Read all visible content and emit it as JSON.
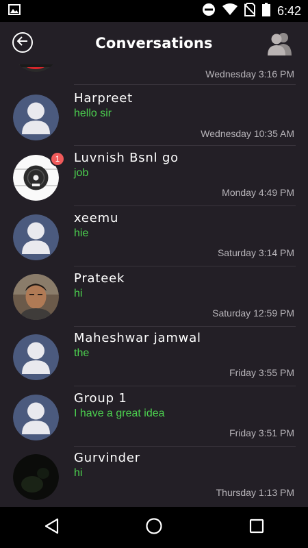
{
  "status_bar": {
    "time": "6:42",
    "icons": [
      "image-notification-icon",
      "do-not-disturb-icon",
      "wifi-icon",
      "no-sim-icon",
      "battery-icon"
    ]
  },
  "header": {
    "title": "Conversations",
    "back_icon": "back-arrow-circle-icon",
    "contacts_icon": "contacts-people-icon"
  },
  "conversations": [
    {
      "name": "",
      "message": "",
      "time": "Wednesday 3:16 PM",
      "avatar": "partial-red-avatar"
    },
    {
      "name": "Harpreet",
      "message": "hello sir",
      "time": "Wednesday 10:35 AM",
      "avatar": "default-person"
    },
    {
      "name": "Luvnish Bsnl go",
      "message": "job",
      "time": "Monday 4:49 PM",
      "avatar": "record-player",
      "unread": "1"
    },
    {
      "name": "xeemu",
      "message": "hie",
      "time": "Saturday 3:14 PM",
      "avatar": "default-person"
    },
    {
      "name": "Prateek",
      "message": "hi",
      "time": "Saturday 12:59 PM",
      "avatar": "photo-face"
    },
    {
      "name": "Maheshwar jamwal",
      "message": "the",
      "time": "Friday 3:55 PM",
      "avatar": "default-person"
    },
    {
      "name": "Group 1",
      "message": "I have a great idea",
      "time": "Friday 3:51 PM",
      "avatar": "default-person"
    },
    {
      "name": "Gurvinder",
      "message": "hi",
      "time": "Thursday 1:13 PM",
      "avatar": "dark-photo"
    }
  ],
  "nav_bar": {
    "icons": [
      "back-triangle-icon",
      "home-circle-icon",
      "recents-square-icon"
    ]
  },
  "colors": {
    "background": "#231f26",
    "message_text": "#4cd14f",
    "time_text": "#b8b5ba",
    "avatar_bg": "#4b5a7e",
    "badge": "#f05a5a"
  }
}
